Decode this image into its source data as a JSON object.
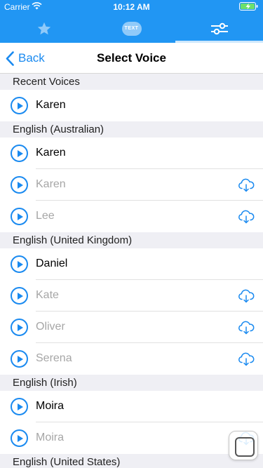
{
  "status": {
    "carrier": "Carrier",
    "time": "10:12 AM"
  },
  "colors": {
    "accent": "#2196f3",
    "link": "#1a8af0",
    "disabled": "#a6a6a6"
  },
  "tabs": [
    {
      "icon": "star-icon"
    },
    {
      "icon": "text-bubble-icon",
      "label": "TEXT"
    },
    {
      "icon": "sliders-icon",
      "active": true
    }
  ],
  "nav": {
    "back": "Back",
    "title": "Select Voice"
  },
  "sections": [
    {
      "title": "Recent Voices",
      "items": [
        {
          "name": "Karen",
          "available": true
        }
      ]
    },
    {
      "title": "English (Australian)",
      "items": [
        {
          "name": "Karen",
          "available": true
        },
        {
          "name": "Karen",
          "available": false
        },
        {
          "name": "Lee",
          "available": false
        }
      ]
    },
    {
      "title": "English (United Kingdom)",
      "items": [
        {
          "name": "Daniel",
          "available": true
        },
        {
          "name": "Kate",
          "available": false
        },
        {
          "name": "Oliver",
          "available": false
        },
        {
          "name": "Serena",
          "available": false
        }
      ]
    },
    {
      "title": "English (Irish)",
      "items": [
        {
          "name": "Moira",
          "available": true
        },
        {
          "name": "Moira",
          "available": false
        }
      ]
    },
    {
      "title": "English (United States)",
      "items": []
    }
  ]
}
